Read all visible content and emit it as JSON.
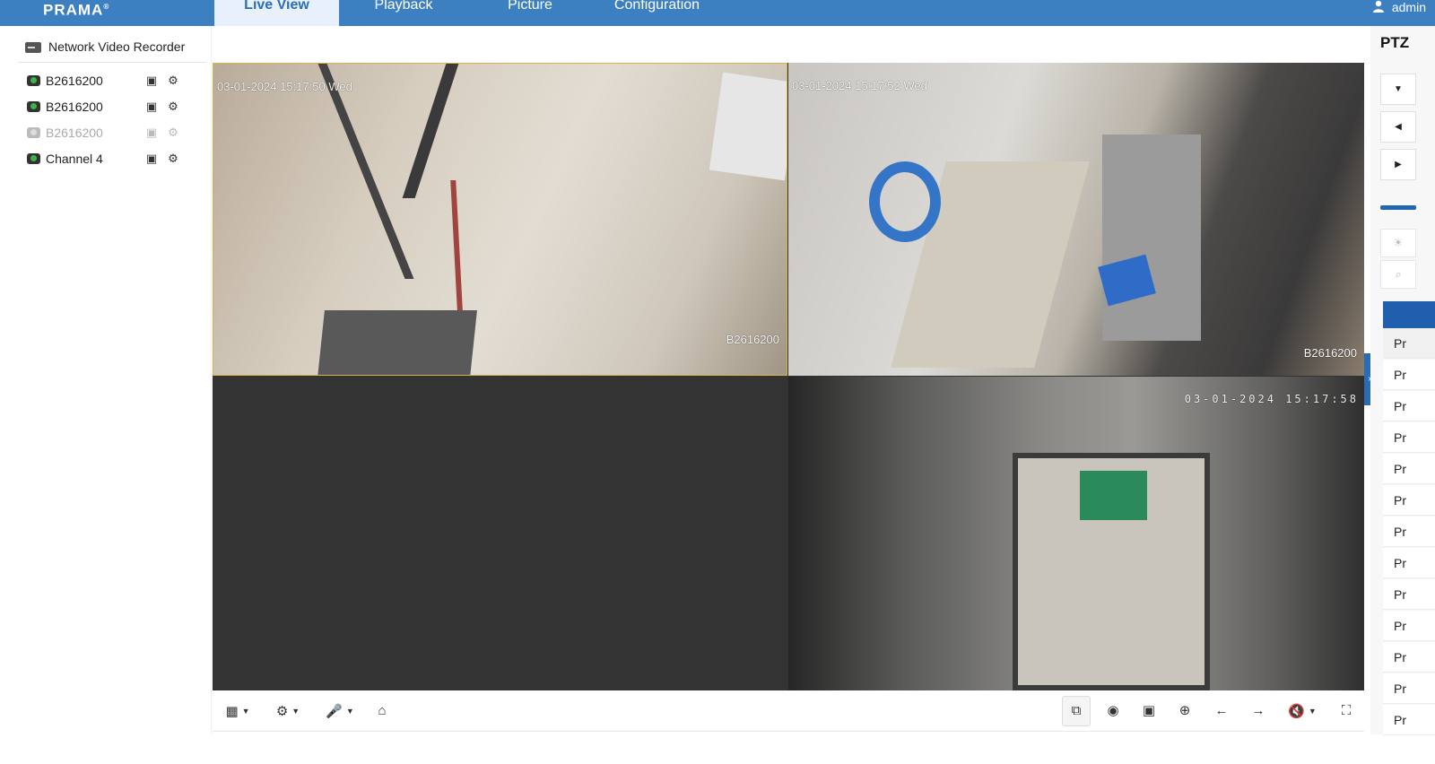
{
  "header": {
    "logo": "PRAMA",
    "logo_mark": "®",
    "tabs": [
      {
        "label": "Live View",
        "active": true
      },
      {
        "label": "Playback",
        "active": false
      },
      {
        "label": "Picture",
        "active": false
      },
      {
        "label": "Configuration",
        "active": false
      }
    ],
    "user": "admin"
  },
  "tree": {
    "root": "Network Video Recorder",
    "channels": [
      {
        "name": "B2616200",
        "online": true
      },
      {
        "name": "B2616200",
        "online": true
      },
      {
        "name": "B2616200",
        "online": false
      },
      {
        "name": "Channel 4",
        "online": true
      }
    ]
  },
  "video": {
    "tiles": [
      {
        "time": "03-01-2024 15:17:50 Wed",
        "name": "B2616200",
        "selected": true
      },
      {
        "time": "03-01-2024 15:17:52 Wed",
        "name": "B2616200",
        "selected": false
      },
      {
        "time": "",
        "name": "",
        "selected": false
      },
      {
        "time": "03-01-2024  15:17:58",
        "name": "",
        "selected": false
      }
    ]
  },
  "toolbar": {
    "left": [
      "layout-icon",
      "stream-icon",
      "microphone-icon",
      "zero-channel-icon"
    ],
    "right": [
      "stop-all-icon",
      "capture-icon",
      "record-icon",
      "digital-zoom-icon",
      "previous-page-icon",
      "next-page-icon",
      "volume-icon",
      "fullscreen-icon"
    ]
  },
  "ptz": {
    "title": "PTZ",
    "preset_label": "Pr",
    "preset_count": 13
  },
  "colors": {
    "nav": "#3d80c2",
    "active_tab_bg": "#e8f1fb",
    "selected_tile_border": "#d9b24a",
    "accent": "#1f5fae"
  }
}
